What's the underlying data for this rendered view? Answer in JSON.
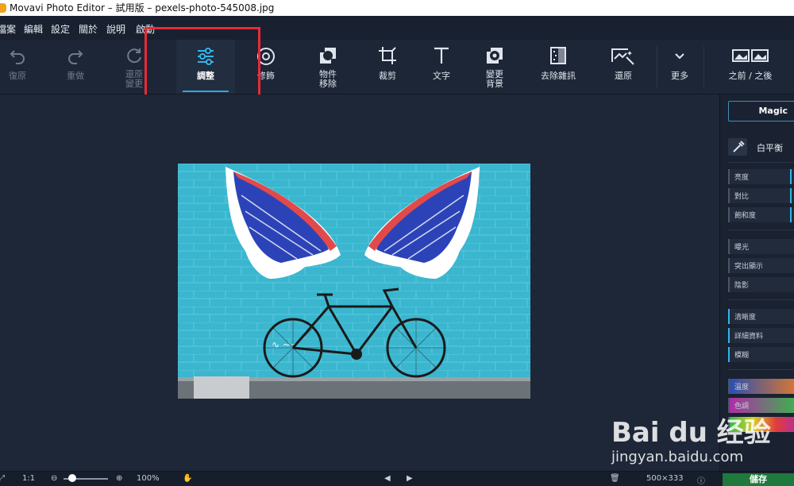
{
  "window": {
    "title": "Movavi Photo Editor – 試用版 – pexels-photo-545008.jpg"
  },
  "menu": [
    {
      "label": "檔案"
    },
    {
      "label": "編輯"
    },
    {
      "label": "設定"
    },
    {
      "label": "關於"
    },
    {
      "label": "說明"
    },
    {
      "label": "啟動"
    }
  ],
  "toolbar": {
    "undo": "復原",
    "redo": "重做",
    "restore_changes": "還原\n變更",
    "adjust": "調整",
    "retouch": "修飾",
    "object_removal": "物件\n移除",
    "crop": "裁剪",
    "text": "文字",
    "change_background": "變更\n背景",
    "denoise": "去除雜訊",
    "restore": "還原",
    "more": "更多",
    "before_after": "之前 / 之後"
  },
  "panel": {
    "magic": "Magic",
    "white_balance": "白平衡",
    "sliders_group1": [
      "亮度",
      "對比",
      "飽和度"
    ],
    "sliders_group2": [
      "曝光",
      "突出顯示",
      "陰影"
    ],
    "sliders_group3": [
      "清晰度",
      "詳細資料",
      "模糊"
    ],
    "sliders_group4": [
      "溫度",
      "色調"
    ]
  },
  "bottom": {
    "fit": "1:1",
    "zoom": "100%",
    "size": "500×333",
    "save": "儲存"
  },
  "watermark": {
    "brand": "Bai du 经验",
    "sub": "jingyan.baidu.com"
  },
  "colors": {
    "accent": "#2fa7de",
    "highlight": "#ea2a35",
    "wall": "#3ab6cf"
  }
}
